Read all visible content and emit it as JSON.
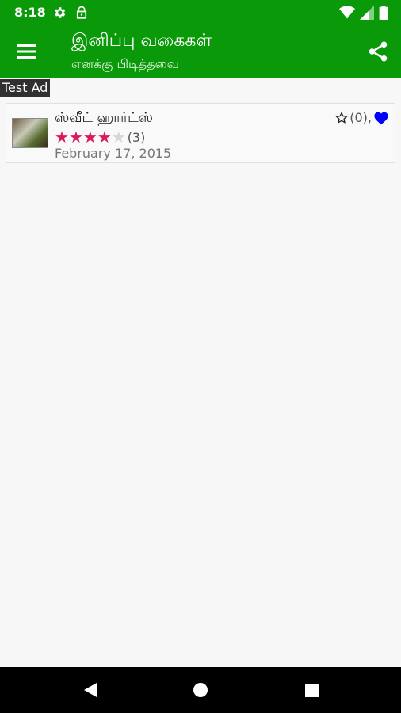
{
  "status_bar": {
    "time": "8:18"
  },
  "app_bar": {
    "title": "இனிப்பு வகைகள்",
    "subtitle": "எனக்கு பிடித்தவை"
  },
  "ad": {
    "label": "Test Ad"
  },
  "list": {
    "items": [
      {
        "title": "ஸ்வீட் ஹார்ட்ஸ்",
        "rating": 4,
        "rating_max": 5,
        "rating_count": "(3)",
        "date": "February 17, 2015",
        "favorite_count": "(0),"
      }
    ]
  },
  "colors": {
    "app_bar": "#0a9a09",
    "star": "#d81b60",
    "heart": "#0000ff"
  }
}
